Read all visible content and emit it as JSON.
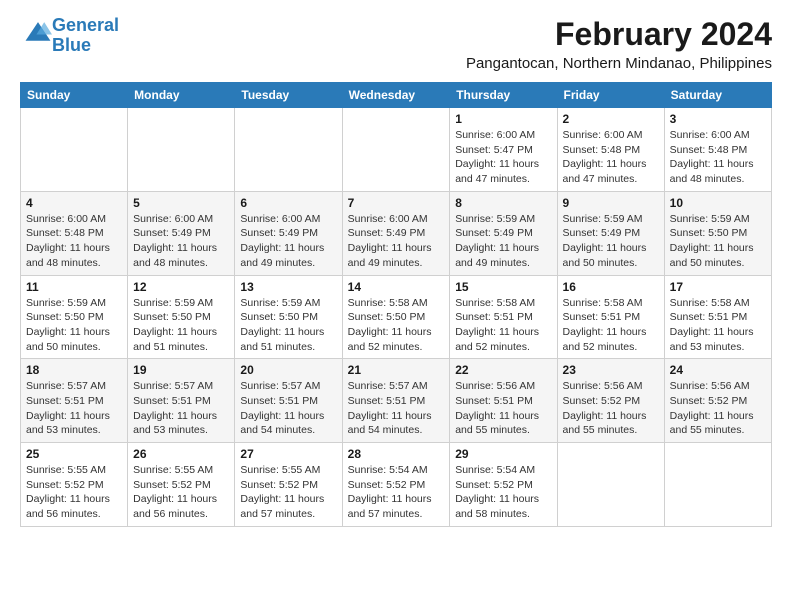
{
  "logo": {
    "line1": "General",
    "line2": "Blue"
  },
  "title": {
    "month_year": "February 2024",
    "location": "Pangantocan, Northern Mindanao, Philippines"
  },
  "days_of_week": [
    "Sunday",
    "Monday",
    "Tuesday",
    "Wednesday",
    "Thursday",
    "Friday",
    "Saturday"
  ],
  "weeks": [
    [
      {
        "day": "",
        "content": ""
      },
      {
        "day": "",
        "content": ""
      },
      {
        "day": "",
        "content": ""
      },
      {
        "day": "",
        "content": ""
      },
      {
        "day": "1",
        "content": "Sunrise: 6:00 AM\nSunset: 5:47 PM\nDaylight: 11 hours\nand 47 minutes."
      },
      {
        "day": "2",
        "content": "Sunrise: 6:00 AM\nSunset: 5:48 PM\nDaylight: 11 hours\nand 47 minutes."
      },
      {
        "day": "3",
        "content": "Sunrise: 6:00 AM\nSunset: 5:48 PM\nDaylight: 11 hours\nand 48 minutes."
      }
    ],
    [
      {
        "day": "4",
        "content": "Sunrise: 6:00 AM\nSunset: 5:48 PM\nDaylight: 11 hours\nand 48 minutes."
      },
      {
        "day": "5",
        "content": "Sunrise: 6:00 AM\nSunset: 5:49 PM\nDaylight: 11 hours\nand 48 minutes."
      },
      {
        "day": "6",
        "content": "Sunrise: 6:00 AM\nSunset: 5:49 PM\nDaylight: 11 hours\nand 49 minutes."
      },
      {
        "day": "7",
        "content": "Sunrise: 6:00 AM\nSunset: 5:49 PM\nDaylight: 11 hours\nand 49 minutes."
      },
      {
        "day": "8",
        "content": "Sunrise: 5:59 AM\nSunset: 5:49 PM\nDaylight: 11 hours\nand 49 minutes."
      },
      {
        "day": "9",
        "content": "Sunrise: 5:59 AM\nSunset: 5:49 PM\nDaylight: 11 hours\nand 50 minutes."
      },
      {
        "day": "10",
        "content": "Sunrise: 5:59 AM\nSunset: 5:50 PM\nDaylight: 11 hours\nand 50 minutes."
      }
    ],
    [
      {
        "day": "11",
        "content": "Sunrise: 5:59 AM\nSunset: 5:50 PM\nDaylight: 11 hours\nand 50 minutes."
      },
      {
        "day": "12",
        "content": "Sunrise: 5:59 AM\nSunset: 5:50 PM\nDaylight: 11 hours\nand 51 minutes."
      },
      {
        "day": "13",
        "content": "Sunrise: 5:59 AM\nSunset: 5:50 PM\nDaylight: 11 hours\nand 51 minutes."
      },
      {
        "day": "14",
        "content": "Sunrise: 5:58 AM\nSunset: 5:50 PM\nDaylight: 11 hours\nand 52 minutes."
      },
      {
        "day": "15",
        "content": "Sunrise: 5:58 AM\nSunset: 5:51 PM\nDaylight: 11 hours\nand 52 minutes."
      },
      {
        "day": "16",
        "content": "Sunrise: 5:58 AM\nSunset: 5:51 PM\nDaylight: 11 hours\nand 52 minutes."
      },
      {
        "day": "17",
        "content": "Sunrise: 5:58 AM\nSunset: 5:51 PM\nDaylight: 11 hours\nand 53 minutes."
      }
    ],
    [
      {
        "day": "18",
        "content": "Sunrise: 5:57 AM\nSunset: 5:51 PM\nDaylight: 11 hours\nand 53 minutes."
      },
      {
        "day": "19",
        "content": "Sunrise: 5:57 AM\nSunset: 5:51 PM\nDaylight: 11 hours\nand 53 minutes."
      },
      {
        "day": "20",
        "content": "Sunrise: 5:57 AM\nSunset: 5:51 PM\nDaylight: 11 hours\nand 54 minutes."
      },
      {
        "day": "21",
        "content": "Sunrise: 5:57 AM\nSunset: 5:51 PM\nDaylight: 11 hours\nand 54 minutes."
      },
      {
        "day": "22",
        "content": "Sunrise: 5:56 AM\nSunset: 5:51 PM\nDaylight: 11 hours\nand 55 minutes."
      },
      {
        "day": "23",
        "content": "Sunrise: 5:56 AM\nSunset: 5:52 PM\nDaylight: 11 hours\nand 55 minutes."
      },
      {
        "day": "24",
        "content": "Sunrise: 5:56 AM\nSunset: 5:52 PM\nDaylight: 11 hours\nand 55 minutes."
      }
    ],
    [
      {
        "day": "25",
        "content": "Sunrise: 5:55 AM\nSunset: 5:52 PM\nDaylight: 11 hours\nand 56 minutes."
      },
      {
        "day": "26",
        "content": "Sunrise: 5:55 AM\nSunset: 5:52 PM\nDaylight: 11 hours\nand 56 minutes."
      },
      {
        "day": "27",
        "content": "Sunrise: 5:55 AM\nSunset: 5:52 PM\nDaylight: 11 hours\nand 57 minutes."
      },
      {
        "day": "28",
        "content": "Sunrise: 5:54 AM\nSunset: 5:52 PM\nDaylight: 11 hours\nand 57 minutes."
      },
      {
        "day": "29",
        "content": "Sunrise: 5:54 AM\nSunset: 5:52 PM\nDaylight: 11 hours\nand 58 minutes."
      },
      {
        "day": "",
        "content": ""
      },
      {
        "day": "",
        "content": ""
      }
    ]
  ]
}
